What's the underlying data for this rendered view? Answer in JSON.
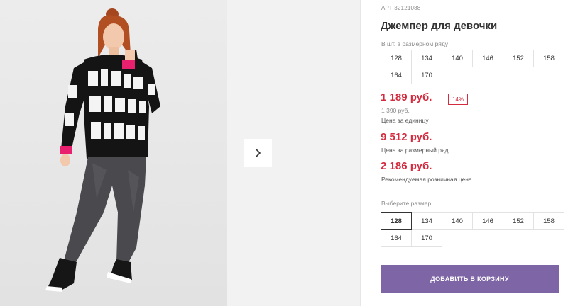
{
  "gallery": {
    "next_icon": "chevron-right-icon",
    "background": "#e9e9e9"
  },
  "product": {
    "article_label": "АРТ",
    "article_number": "32121088",
    "title": "Джемпер для девочки",
    "sizes_in_row_label": "В шт. в размерном ряду",
    "sizes_in_row": [
      "128",
      "134",
      "140",
      "146",
      "152",
      "158",
      "164",
      "170"
    ],
    "price_unit": "1 189 руб.",
    "discount": "14%",
    "old_price": "1 390 руб.",
    "price_unit_caption": "Цена за единицу",
    "price_row": "9 512 руб.",
    "price_row_caption": "Цена за размерный ряд",
    "price_retail": "2 186 руб.",
    "price_retail_caption": "Рекомендуемая розничная цена",
    "choose_size_label": "Выберите размер:",
    "choose_sizes": [
      "128",
      "134",
      "140",
      "146",
      "152",
      "158",
      "164",
      "170"
    ],
    "selected_size": "128",
    "add_to_cart": "ДОБАВИТЬ В КОРЗИНУ"
  },
  "colors": {
    "price_red": "#d42b3e",
    "button_purple": "#7d65a6",
    "accent_pink": "#e8206e"
  }
}
